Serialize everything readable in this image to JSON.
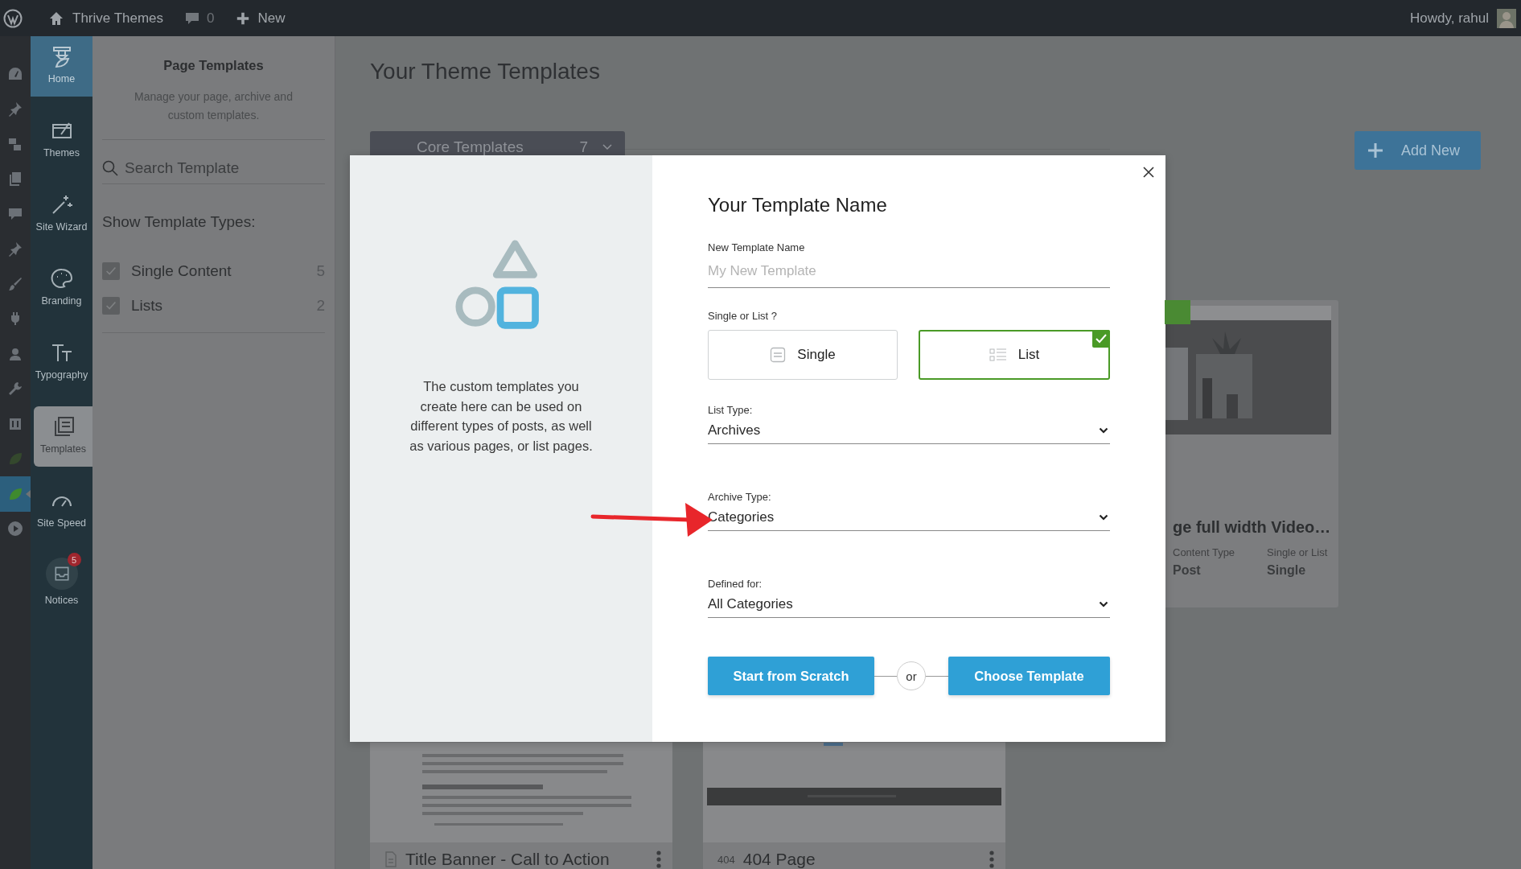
{
  "top_bar": {
    "site_name": "Thrive Themes",
    "comments_count": "0",
    "new_label": "New",
    "greeting": "Howdy, rahul"
  },
  "admin_menu": [
    {
      "selected": false
    },
    {
      "selected": false
    },
    {
      "selected": false
    },
    {
      "selected": false
    },
    {
      "selected": false
    },
    {
      "selected": false
    },
    {
      "selected": false
    },
    {
      "selected": false
    },
    {
      "selected": false
    },
    {
      "selected": false
    },
    {
      "selected": false
    },
    {
      "selected": false
    },
    {
      "selected": true
    },
    {
      "selected": false
    }
  ],
  "thrive_nav": [
    {
      "label": "Home",
      "kind": "home",
      "selected": false
    },
    {
      "label": "Themes",
      "kind": "item",
      "selected": false
    },
    {
      "label": "Site Wizard",
      "kind": "item",
      "selected": false
    },
    {
      "label": "Branding",
      "kind": "item",
      "selected": false
    },
    {
      "label": "Typography",
      "kind": "item",
      "selected": false
    },
    {
      "label": "Templates",
      "kind": "item",
      "selected": true
    },
    {
      "label": "Site Speed",
      "kind": "item",
      "selected": false
    },
    {
      "label": "Notices",
      "kind": "notices",
      "badge": "5",
      "selected": false
    }
  ],
  "panel": {
    "title": "Page Templates",
    "description": "Manage your page, archive and custom templates.",
    "search_placeholder": "Search Template",
    "types_heading": "Show Template Types:",
    "types": [
      {
        "label": "Single Content",
        "count": "5",
        "checked": true
      },
      {
        "label": "Lists",
        "count": "2",
        "checked": true
      }
    ]
  },
  "main": {
    "title": "Your Theme Templates",
    "core_dropdown": {
      "label": "Core Templates",
      "count": "7"
    },
    "add_button": "Add New",
    "top_card": {
      "title": "ge full width Video…",
      "meta": [
        {
          "label": "Content Type",
          "value": "Post"
        },
        {
          "label": "Single or List",
          "value": "Single"
        }
      ]
    },
    "bottom_cards": [
      {
        "title": "Title Banner - Call to Action",
        "kind": "document"
      },
      {
        "title": "404 Page",
        "kind": "error",
        "icon_label": "404"
      }
    ]
  },
  "modal": {
    "heading": "Your Template Name",
    "description": "The custom templates you create here can be used on different types of posts, as well as various pages, or list pages.",
    "name_label": "New Template Name",
    "name_placeholder": "My New Template",
    "type_label": "Single or List ?",
    "type_options": [
      {
        "label": "Single",
        "kind": "single",
        "selected": false
      },
      {
        "label": "List",
        "kind": "list",
        "selected": true
      }
    ],
    "selects": [
      {
        "label": "List Type:",
        "value": "Archives"
      },
      {
        "label": "Archive Type:",
        "value": "Categories"
      },
      {
        "label": "Defined for:",
        "value": "All Categories"
      }
    ],
    "primary_button": "Start from Scratch",
    "separator": "or",
    "secondary_button": "Choose Template"
  }
}
